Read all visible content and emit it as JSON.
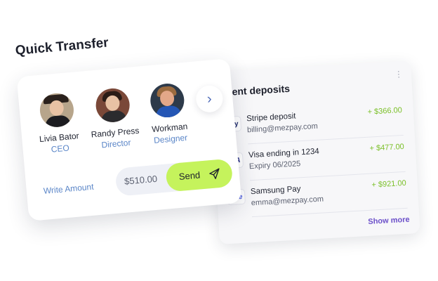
{
  "transfer": {
    "title": "Quick Transfer",
    "people": [
      {
        "name": "Livia Bator",
        "role": "CEO"
      },
      {
        "name": "Randy Press",
        "role": "Director"
      },
      {
        "name": "Workman",
        "role": "Designer"
      }
    ],
    "write_amount_label": "Write Amount",
    "amount_value": "$510.00",
    "send_label": "Send"
  },
  "deposits": {
    "title": "ecent deposits",
    "items": [
      {
        "logo": "Pay",
        "name": "Stripe deposit",
        "sub": "billing@mezpay.com",
        "amount": "+ $366.00"
      },
      {
        "logo": "ISA",
        "name": "Visa ending in 1234",
        "sub": "Expiry 06/2025",
        "amount": "+ $477.00"
      },
      {
        "logo": "ipe",
        "name": "Samsung Pay",
        "sub": "emma@mezpay.com",
        "amount": "+ $921.00"
      }
    ],
    "show_more_label": "Show more"
  },
  "colors": {
    "accent_green": "#c5f35c",
    "amount_green": "#7cc02a",
    "role_blue": "#5b86c8",
    "link_purple": "#6b4fc9"
  },
  "icons": [
    "chevron-right-icon",
    "send-plane-icon",
    "kebab-menu-icon"
  ]
}
